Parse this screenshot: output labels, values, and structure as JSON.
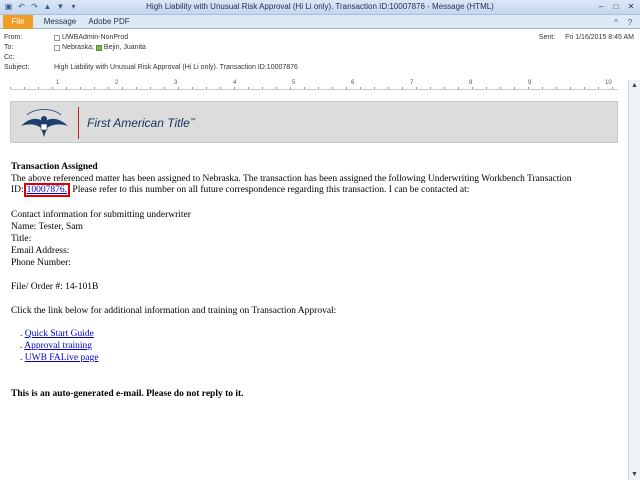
{
  "window": {
    "title": "High Liability with Unusual Risk Approval (Hi Li only). Transaction ID:10007876 - Message (HTML)"
  },
  "ribbon": {
    "tabs": [
      "File",
      "Message",
      "Adobe PDF"
    ]
  },
  "header": {
    "from_label": "From:",
    "from_value": "UWBAdmin-NonProd",
    "to_label": "To:",
    "to_value_1": "Nebraska;",
    "to_value_2": "Bejin, Juanita",
    "cc_label": "Cc:",
    "subject_label": "Subject:",
    "subject_value": "High Liability with Unusual Risk Approval (Hi Li only). Transaction ID:10007876",
    "sent_label": "Sent:",
    "sent_value": "Fri 1/16/2015 8:45 AM"
  },
  "ruler": [
    "1",
    "2",
    "3",
    "4",
    "5",
    "6",
    "7",
    "8",
    "9",
    "10"
  ],
  "email": {
    "brand": "First American Title",
    "brand_tm": "™",
    "heading": "Transaction Assigned",
    "line1": "The above referenced matter has been assigned to Nebraska. The transaction has been assigned the following Underwriting Workbench Transaction",
    "line2_prefix": "ID:",
    "transaction_id": "10007876.",
    "line2_suffix": " Please refer to this number on all future correspondence regarding this transaction. I can be contacted at:",
    "contact_heading": "Contact information for submitting underwriter",
    "name": "Name: Tester, Sam",
    "title": "Title:",
    "email_address": "Email Address:",
    "phone": "Phone Number:",
    "file_order": "File/ Order #: 14-101B",
    "click_link": "Click the link below for additional information and training on Transaction Approval:",
    "links": [
      "Quick Start Guide",
      "Approval training",
      "UWB FALive page"
    ],
    "footer": "This is an auto-generated e-mail. Please do not reply to it."
  }
}
